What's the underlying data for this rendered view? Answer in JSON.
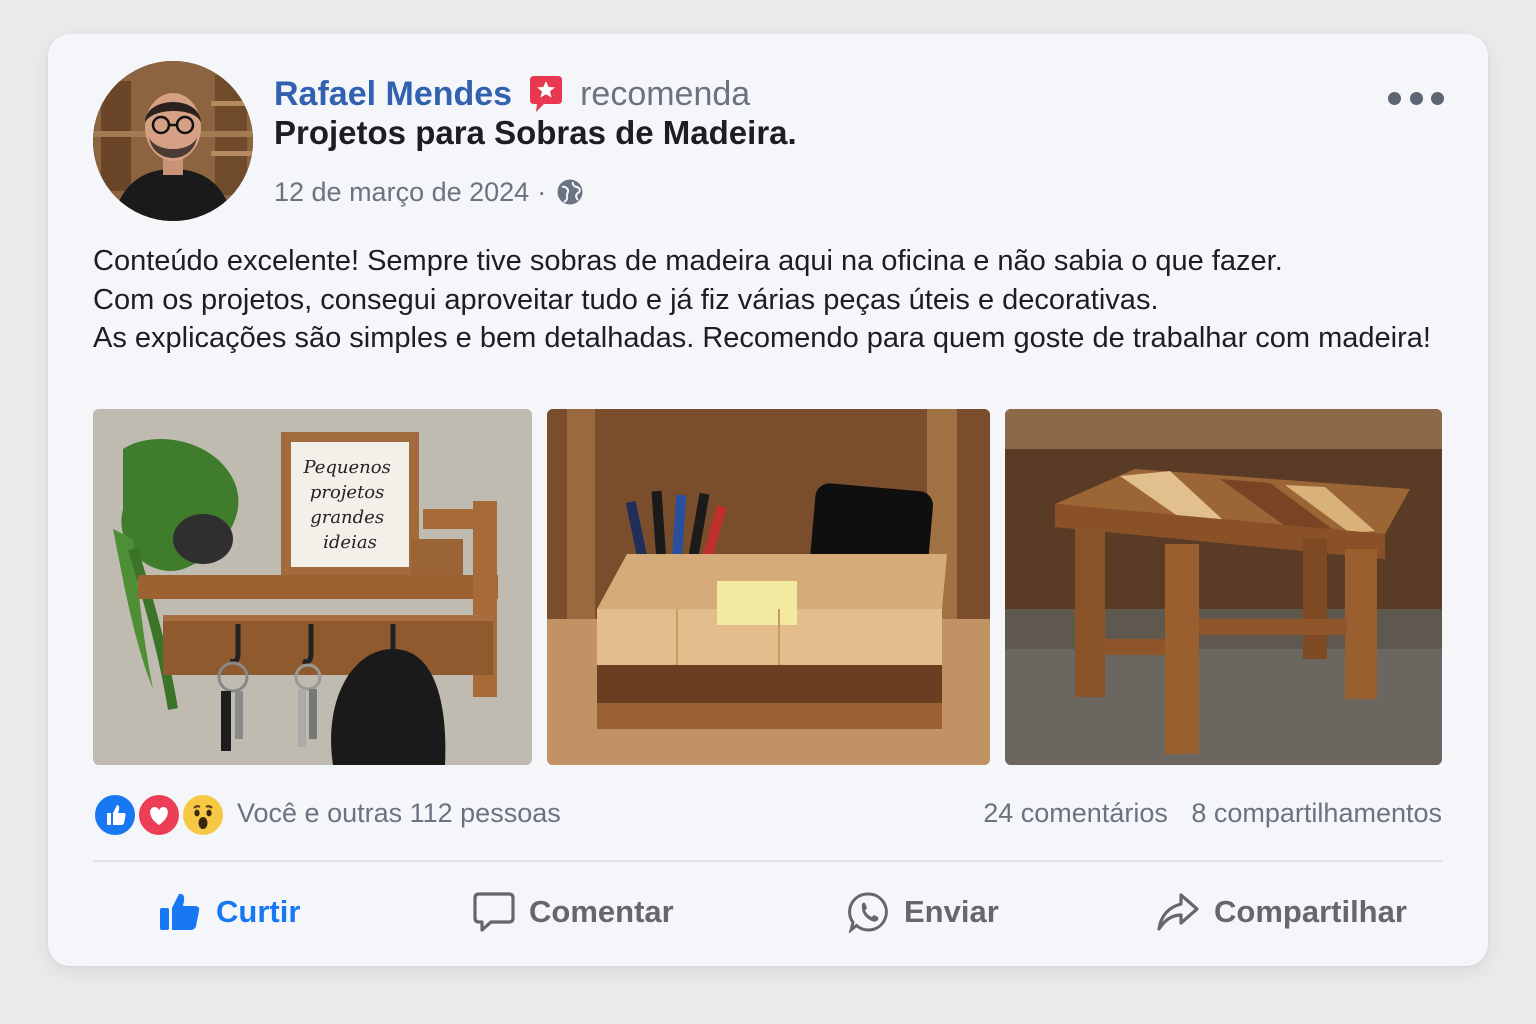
{
  "post": {
    "author": "Rafael Mendes",
    "action_text": "recomenda",
    "page_name": "Projetos para Sobras de Madeira.",
    "date": "12 de março de 2024",
    "separator": "·",
    "audience_icon": "globe-icon",
    "menu_icon": "more-horizontal-icon",
    "text_lines": [
      "Conteúdo excelente! Sempre tive sobras de madeira aqui na oficina e não sabia o que fazer.",
      "Com os projetos, consegui aproveitar tudo e já fiz várias peças úteis e decorativas.",
      "As explicações são simples e bem detalhadas. Recomendo para quem goste de trabalhar com madeira!"
    ],
    "photos": [
      {
        "name": "wall-shelf-photo",
        "frame_text": [
          "Pequenos",
          "projetos",
          "grandes",
          "ideias"
        ]
      },
      {
        "name": "desk-organizer-photo"
      },
      {
        "name": "wooden-stool-photo"
      }
    ]
  },
  "reactions": {
    "icons": [
      "like-reaction-icon",
      "love-reaction-icon",
      "wow-reaction-icon"
    ],
    "summary": "Você e outras 112 pessoas",
    "comments": "24 comentários",
    "shares": "8 compartilhamentos"
  },
  "actions": {
    "like": "Curtir",
    "comment": "Comentar",
    "send": "Enviar",
    "share": "Compartilhar"
  },
  "colors": {
    "author": "#3161b0",
    "badge": "#e8384f",
    "like_active": "#1877f2",
    "muted": "#6b7280",
    "card_bg": "#f5f6f9"
  }
}
